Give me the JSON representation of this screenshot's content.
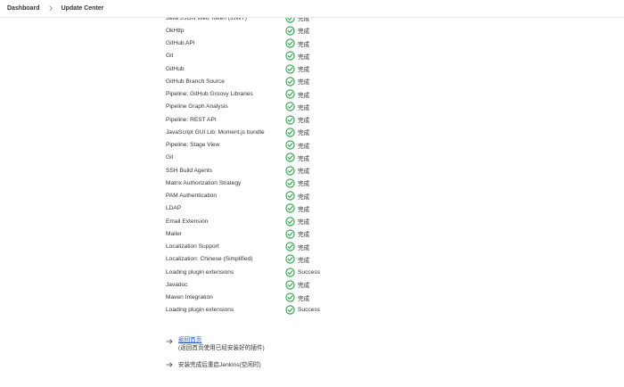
{
  "breadcrumb": {
    "items": [
      "Dashboard",
      "Update Center"
    ]
  },
  "colors": {
    "success_green": "#2aa24a",
    "link_blue": "#2153c6"
  },
  "icons": {
    "status": "check-circle-icon",
    "breadcrumb_separator": "chevron-right-icon",
    "link_arrow": "arrow-right-icon"
  },
  "plugins": [
    {
      "name": "Java JSON Web Token (JJWT)",
      "status": "完成"
    },
    {
      "name": "OkHttp",
      "status": "完成"
    },
    {
      "name": "GitHub API",
      "status": "完成"
    },
    {
      "name": "Git",
      "status": "完成"
    },
    {
      "name": "GitHub",
      "status": "完成"
    },
    {
      "name": "GitHub Branch Source",
      "status": "完成"
    },
    {
      "name": "Pipeline: GitHub Groovy Libraries",
      "status": "完成"
    },
    {
      "name": "Pipeline Graph Analysis",
      "status": "完成"
    },
    {
      "name": "Pipeline: REST API",
      "status": "完成"
    },
    {
      "name": "JavaScript GUI Lib: Moment.js bundle",
      "status": "完成"
    },
    {
      "name": "Pipeline: Stage View",
      "status": "完成"
    },
    {
      "name": "Git",
      "status": "完成"
    },
    {
      "name": "SSH Build Agents",
      "status": "完成"
    },
    {
      "name": "Matrix Authorization Strategy",
      "status": "完成"
    },
    {
      "name": "PAM Authentication",
      "status": "完成"
    },
    {
      "name": "LDAP",
      "status": "完成"
    },
    {
      "name": "Email Extension",
      "status": "完成"
    },
    {
      "name": "Mailer",
      "status": "完成"
    },
    {
      "name": "Localization Support",
      "status": "完成"
    },
    {
      "name": "Localization: Chinese (Simplified)",
      "status": "完成"
    },
    {
      "name": "Loading plugin extensions",
      "status": "Success"
    },
    {
      "name": "Javadoc",
      "status": "完成"
    },
    {
      "name": "Maven Integration",
      "status": "完成"
    },
    {
      "name": "Loading plugin extensions",
      "status": "Success"
    }
  ],
  "links": {
    "home_label": "返回首页",
    "home_sub": "(返回首页使用已经安装好的插件)",
    "restart_label": "安装完成后重启Jenkins(空闲时)"
  }
}
